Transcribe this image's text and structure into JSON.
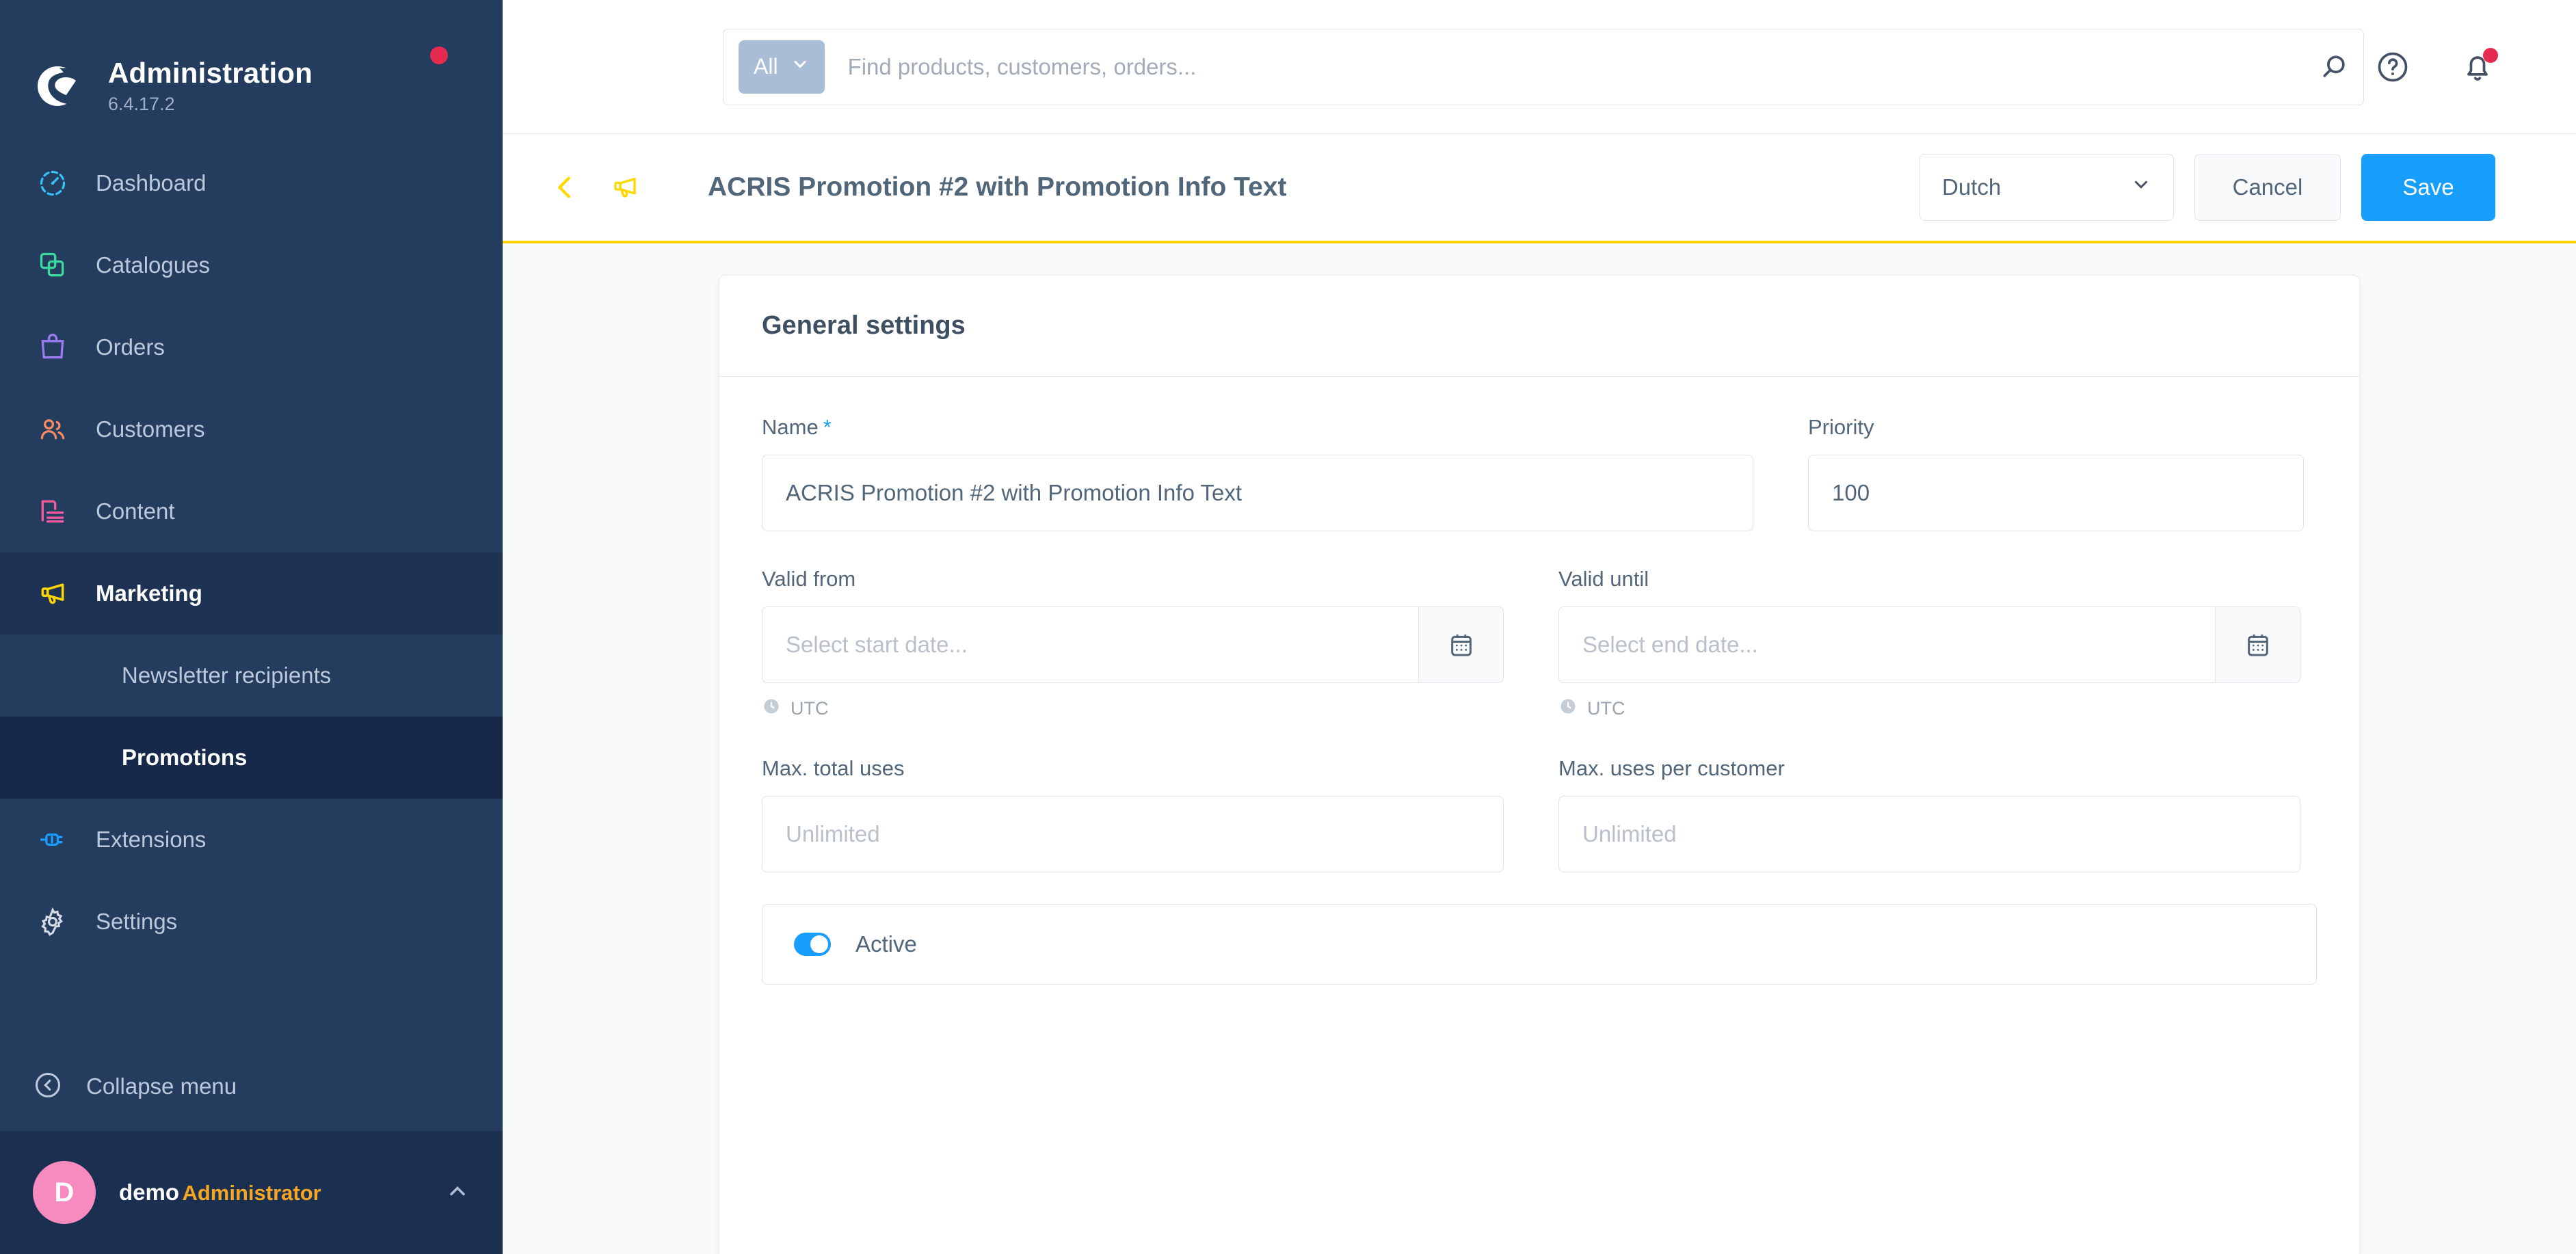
{
  "sidebar": {
    "brand": {
      "title": "Administration",
      "version": "6.4.17.2",
      "status_dot_color": "#e52b50"
    },
    "items": [
      {
        "label": "Dashboard",
        "icon": "dashboard-gauge-icon",
        "color": "#37c0f4"
      },
      {
        "label": "Catalogues",
        "icon": "catalogues-layers-icon",
        "color": "#3cd9a0"
      },
      {
        "label": "Orders",
        "icon": "orders-bag-icon",
        "color": "#9b7bf0"
      },
      {
        "label": "Customers",
        "icon": "customers-people-icon",
        "color": "#f88962"
      },
      {
        "label": "Content",
        "icon": "content-document-icon",
        "color": "#f25b9c"
      },
      {
        "label": "Marketing",
        "icon": "marketing-megaphone-icon",
        "color": "#ffd700"
      }
    ],
    "submenu": [
      {
        "label": "Newsletter recipients",
        "active": false
      },
      {
        "label": "Promotions",
        "active": true
      }
    ],
    "items_after": [
      {
        "label": "Extensions",
        "icon": "extensions-plug-icon",
        "color": "#189eff"
      },
      {
        "label": "Settings",
        "icon": "settings-gear-icon",
        "color": "#d6dce5"
      }
    ],
    "collapse": {
      "label": "Collapse menu",
      "icon": "collapse-chevron-left-icon"
    },
    "user": {
      "initial": "D",
      "name": "demo",
      "role": "Administrator",
      "avatar_color": "#f78bc0",
      "role_color": "#f5a623"
    }
  },
  "topbar": {
    "scope_label": "All",
    "search_placeholder": "Find products, customers, orders...",
    "search_value": "",
    "help_icon": "help-question-circle-icon",
    "notifications_icon": "notification-bell-icon",
    "notifications_badge": true
  },
  "pagehead": {
    "back_icon": "chevron-left-icon",
    "entity_icon": "megaphone-icon",
    "title": "ACRIS Promotion #2 with Promotion Info Text",
    "language": "Dutch",
    "cancel_label": "Cancel",
    "save_label": "Save",
    "accent_color": "#ffd700"
  },
  "card": {
    "title": "General settings",
    "fields": {
      "name": {
        "label": "Name",
        "required_marker": "*",
        "value": "ACRIS Promotion #2 with Promotion Info Text"
      },
      "priority": {
        "label": "Priority",
        "value": "100"
      },
      "valid_from": {
        "label": "Valid from",
        "placeholder": "Select start date...",
        "value": "",
        "timezone": "UTC",
        "icon": "calendar-icon"
      },
      "valid_until": {
        "label": "Valid until",
        "placeholder": "Select end date...",
        "value": "",
        "timezone": "UTC",
        "icon": "calendar-icon"
      },
      "max_total_uses": {
        "label": "Max. total uses",
        "placeholder": "Unlimited",
        "value": ""
      },
      "max_uses_per_customer": {
        "label": "Max. uses per customer",
        "placeholder": "Unlimited",
        "value": ""
      },
      "active": {
        "label": "Active",
        "on": true,
        "color": "#189eff"
      }
    }
  }
}
